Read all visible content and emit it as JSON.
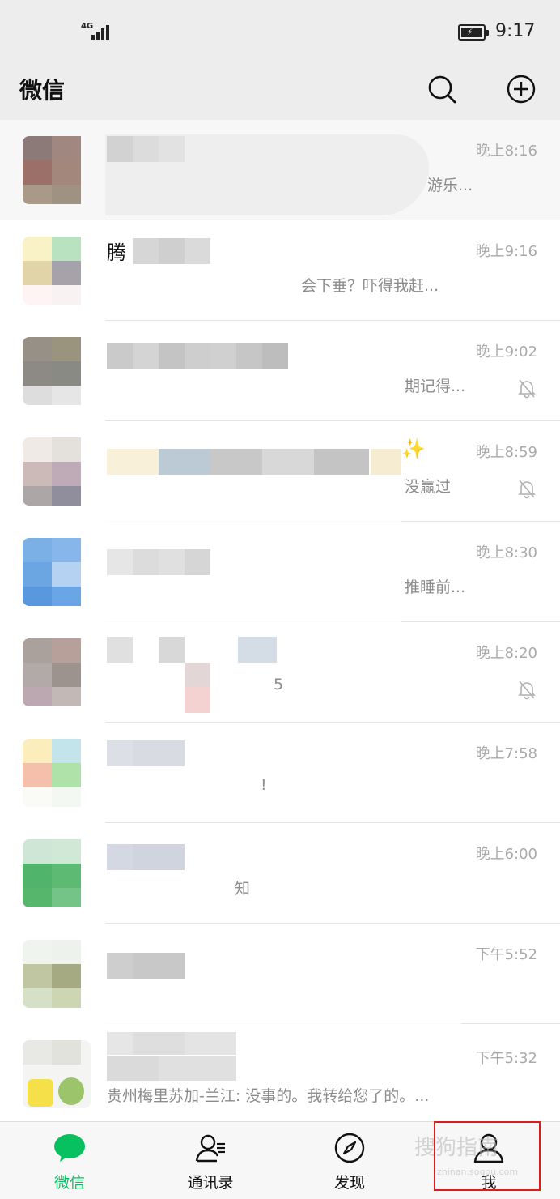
{
  "status_bar": {
    "network_label": "4G",
    "time": "9:17"
  },
  "header": {
    "title": "微信",
    "search_icon": "search-icon",
    "add_icon": "plus-circle-icon"
  },
  "chats": [
    {
      "name": "",
      "preview": "游乐...",
      "time": "晚上8:16",
      "muted": false,
      "pinned": true
    },
    {
      "name": "腾",
      "preview": "会下垂？吓得我赶...",
      "time": "晚上9:16",
      "muted": false,
      "pinned": false
    },
    {
      "name": "",
      "preview": "期记得...",
      "time": "晚上9:02",
      "muted": true,
      "pinned": false
    },
    {
      "name": "✨",
      "preview": "没赢过",
      "time": "晚上8:59",
      "muted": true,
      "pinned": false
    },
    {
      "name": "",
      "preview": "推睡前...",
      "time": "晚上8:30",
      "muted": false,
      "pinned": false
    },
    {
      "name": "",
      "preview": "5",
      "time": "晚上8:20",
      "muted": true,
      "pinned": false
    },
    {
      "name": "",
      "preview": "!",
      "time": "晚上7:58",
      "muted": false,
      "pinned": false
    },
    {
      "name": "",
      "preview": "知",
      "time": "晚上6:00",
      "muted": false,
      "pinned": false
    },
    {
      "name": "",
      "preview": "",
      "time": "下午5:52",
      "muted": false,
      "pinned": false
    },
    {
      "name": "",
      "preview": "贵州梅里苏加-兰江: 没事的。我转给您了的。...",
      "time": "下午5:32",
      "muted": false,
      "pinned": false
    }
  ],
  "tabs": [
    {
      "label": "微信",
      "icon": "chat-bubble-icon",
      "active": true
    },
    {
      "label": "通讯录",
      "icon": "contacts-icon",
      "active": false
    },
    {
      "label": "发现",
      "icon": "compass-icon",
      "active": false
    },
    {
      "label": "我",
      "icon": "person-icon",
      "active": false
    }
  ],
  "watermark": {
    "text": "搜狗指南",
    "sub": "zhinan.sogou.com"
  },
  "colors": {
    "accent": "#07c160",
    "highlight": "#e11b1b",
    "background": "#ededed"
  }
}
